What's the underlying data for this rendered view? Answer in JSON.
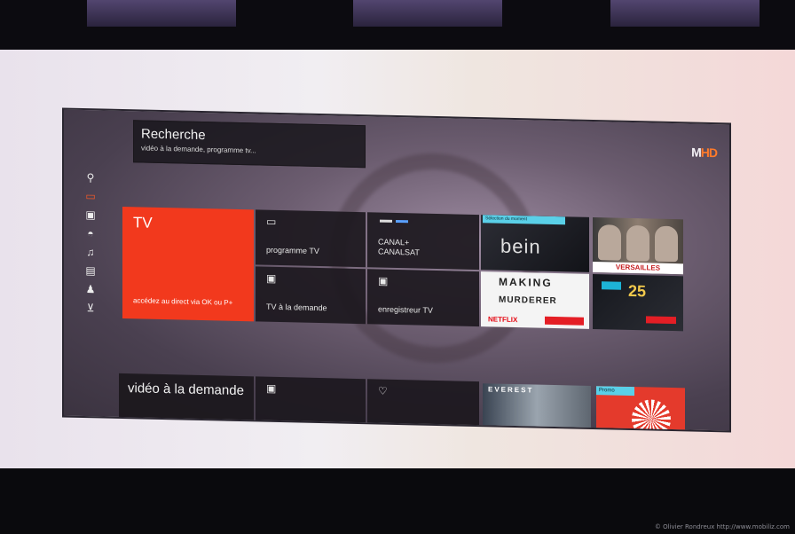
{
  "search": {
    "title": "Recherche",
    "subtitle": "vidéo à la demande, programme tv..."
  },
  "brand": {
    "prefix": "M",
    "highlight": "HD"
  },
  "sidebar": {
    "items": [
      {
        "icon": "search-icon",
        "glyph": "⚲"
      },
      {
        "icon": "tv-icon",
        "glyph": "▭",
        "active": true
      },
      {
        "icon": "film-icon",
        "glyph": "▣"
      },
      {
        "icon": "gamepad-icon",
        "glyph": "◓"
      },
      {
        "icon": "music-icon",
        "glyph": "♫"
      },
      {
        "icon": "photo-icon",
        "glyph": "▤"
      },
      {
        "icon": "user-icon",
        "glyph": "♟"
      },
      {
        "icon": "cart-icon",
        "glyph": "⊻"
      }
    ]
  },
  "tiles": {
    "tv_title": "TV",
    "tv_desc": "accédez au direct via OK ou P+",
    "programme": "programme TV",
    "canal": "CANAL+ CANALSAT",
    "replay": "TV à la demande",
    "enregistreur": "enregistreur TV"
  },
  "promos": {
    "bein_tag": "Sélection du moment",
    "bein_logo": "bein",
    "making_l1": "MAKING",
    "making_l2": "MURDERER",
    "netflix": "NETFLIX",
    "vf_band": "VERSAILLES",
    "promo_number": "25",
    "everest": "EVEREST",
    "prem_tag": "Promo"
  },
  "row2": {
    "vod_title": "vidéo à la demande"
  },
  "footer": {
    "credit": "© Olivier Rondreux http://www.mobiliz.com"
  },
  "colors": {
    "accent": "#f2391d"
  }
}
